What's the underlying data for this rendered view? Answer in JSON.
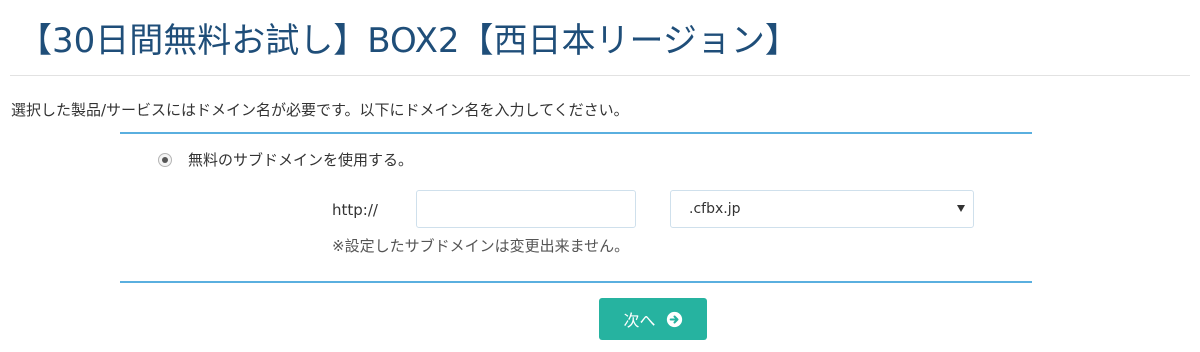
{
  "header": {
    "title": "【30日間無料お試し】BOX2【西日本リージョン】"
  },
  "intro": {
    "text": "選択した製品/サービスにはドメイン名が必要です。以下にドメイン名を入力してください。"
  },
  "domain_form": {
    "option_free_subdomain": {
      "label": "無料のサブドメインを使用する。",
      "selected": true
    },
    "prefix": "http://",
    "subdomain_input": {
      "value": "",
      "placeholder": ""
    },
    "domain_select": {
      "selected": ".cfbx.jp"
    },
    "note": "※設定したサブドメインは変更出来ません。"
  },
  "actions": {
    "next_label": "次へ",
    "next_icon": "arrow-circle-right-icon",
    "button_color": "#26b3a0"
  },
  "colors": {
    "title": "#1f4e79",
    "panel_border": "#5aafdf",
    "button": "#26b3a0"
  }
}
